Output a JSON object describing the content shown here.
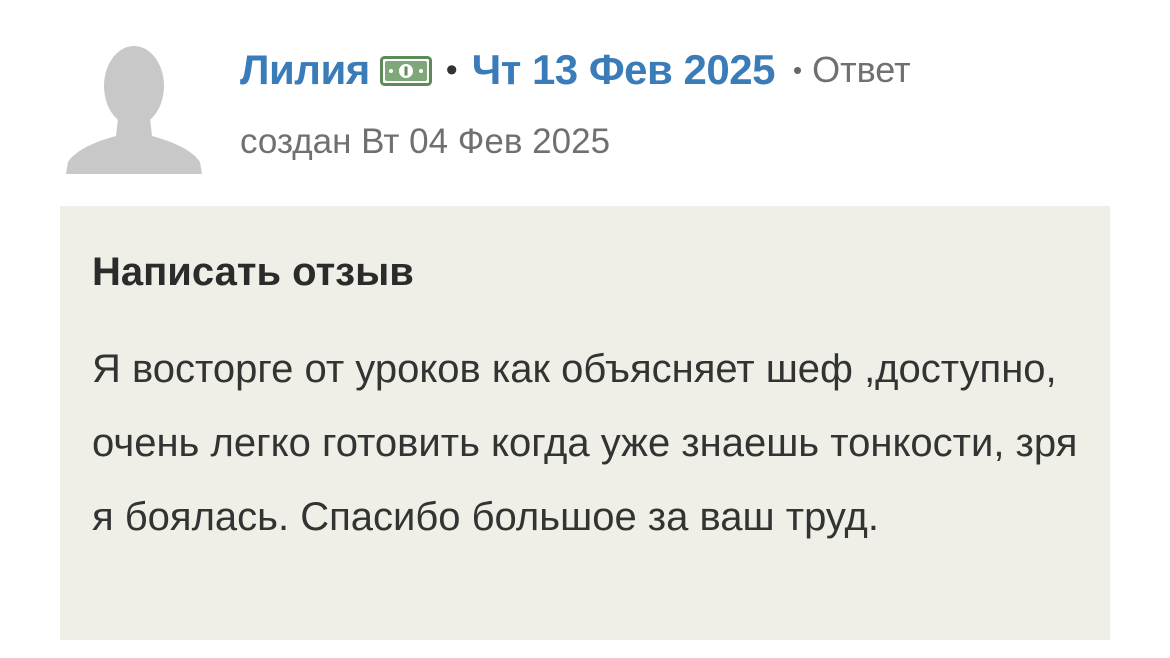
{
  "comment": {
    "author": "Лилия",
    "author_badge_icon": "money-bill-icon",
    "separator": "•",
    "date": "Чт 13 Фев 2025",
    "reply_label": "Ответ",
    "created": "создан Вт 04 Фев 2025",
    "avatar_icon": "default-user-avatar-icon"
  },
  "review": {
    "title": "Написать отзыв",
    "text": "Я восторге от уроков как объясняет шеф ,доступно, очень легко готовить когда уже знаешь тонкости, зря я боялась. Спасибо большое за ваш труд."
  },
  "colors": {
    "link_blue": "#3a7cb8",
    "muted_gray": "#707070",
    "review_bg": "#efefe8",
    "badge_green": "#5e8a5a"
  }
}
